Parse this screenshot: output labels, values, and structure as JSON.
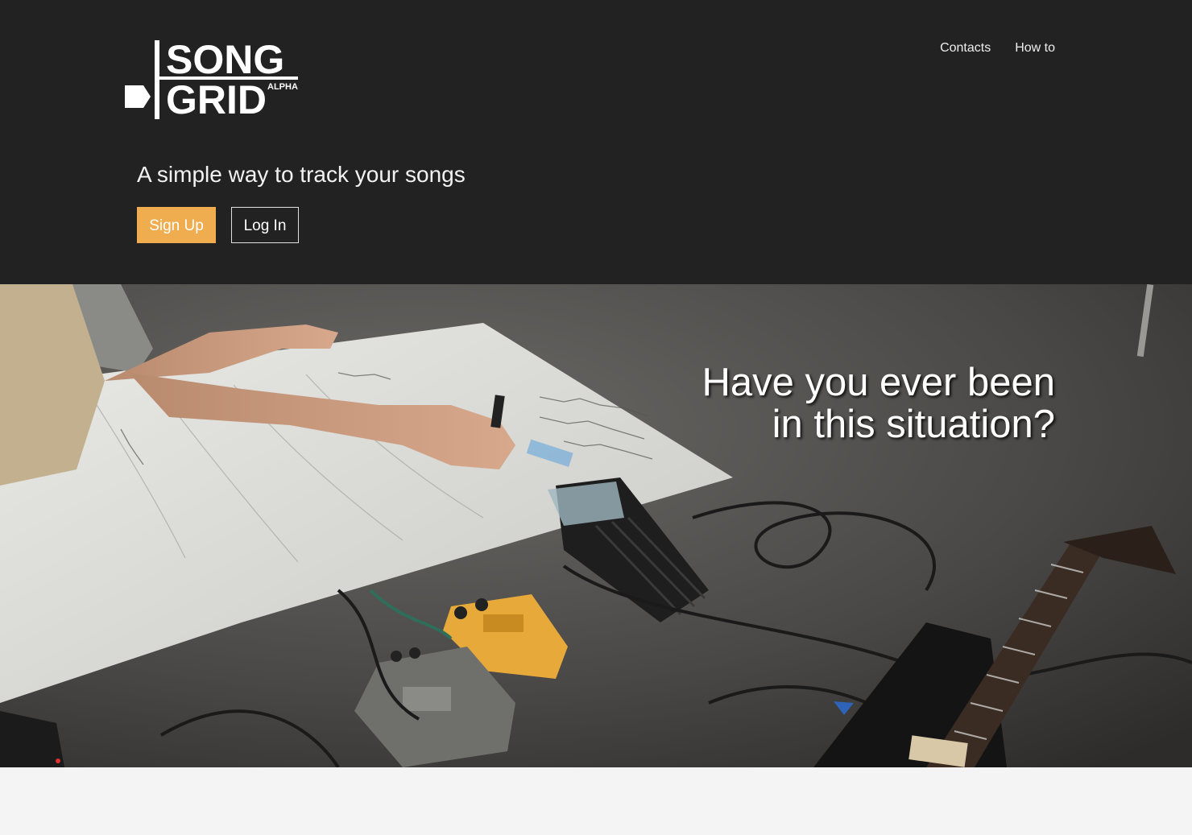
{
  "brand": {
    "logo_line1": "SONG",
    "logo_line2": "GRID",
    "logo_badge": "ALPHA"
  },
  "nav": {
    "contacts": "Contacts",
    "how_to": "How to"
  },
  "header": {
    "tagline": "A simple way to track your songs",
    "signup_label": "Sign Up",
    "login_label": "Log In"
  },
  "hero": {
    "line1": "Have you ever been",
    "line2": "in this situation?"
  },
  "colors": {
    "header_bg": "#222222",
    "accent": "#efad4f",
    "page_bg": "#f4f4f4"
  }
}
